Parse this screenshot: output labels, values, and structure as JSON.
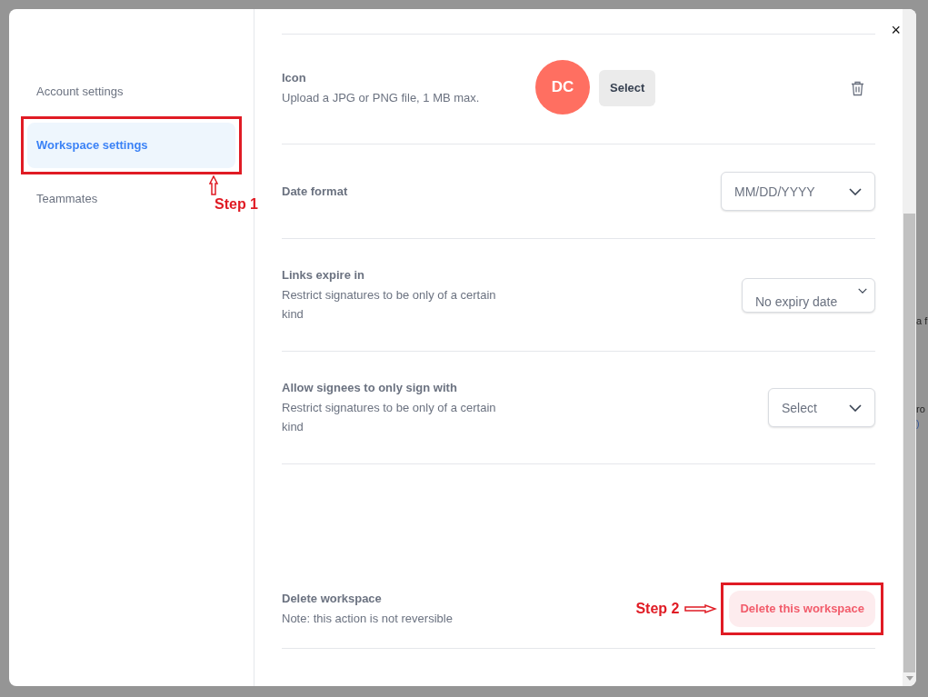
{
  "sidebar": {
    "items": [
      {
        "label": "Account settings",
        "selected": false
      },
      {
        "label": "Workspace settings",
        "selected": true
      },
      {
        "label": "Teammates",
        "selected": false
      }
    ]
  },
  "close_button": "×",
  "settings": [
    {
      "kind": "icon",
      "title": "Icon",
      "description": "Upload a JPG or PNG file, 1 MB max.",
      "avatar": "DC",
      "button": "Select"
    },
    {
      "kind": "dropdown",
      "title": "Date format",
      "value": "MM/DD/YYYY"
    },
    {
      "kind": "dropdown",
      "title": "Links expire in",
      "description": "Restrict signatures to be only of a certain kind",
      "value": "No expiry date"
    },
    {
      "kind": "dropdown",
      "title": "Allow signees to only sign with",
      "description": "Restrict signatures to be only of a certain kind",
      "value": "Select"
    },
    {
      "kind": "danger",
      "title": "Delete workspace",
      "description": "Note: this action is not reversible",
      "button": "Delete this workspace"
    }
  ],
  "annotations": [
    "Step 1",
    "Step 2"
  ],
  "backdrop_fragments": [
    "a f",
    "ro",
    ")"
  ]
}
